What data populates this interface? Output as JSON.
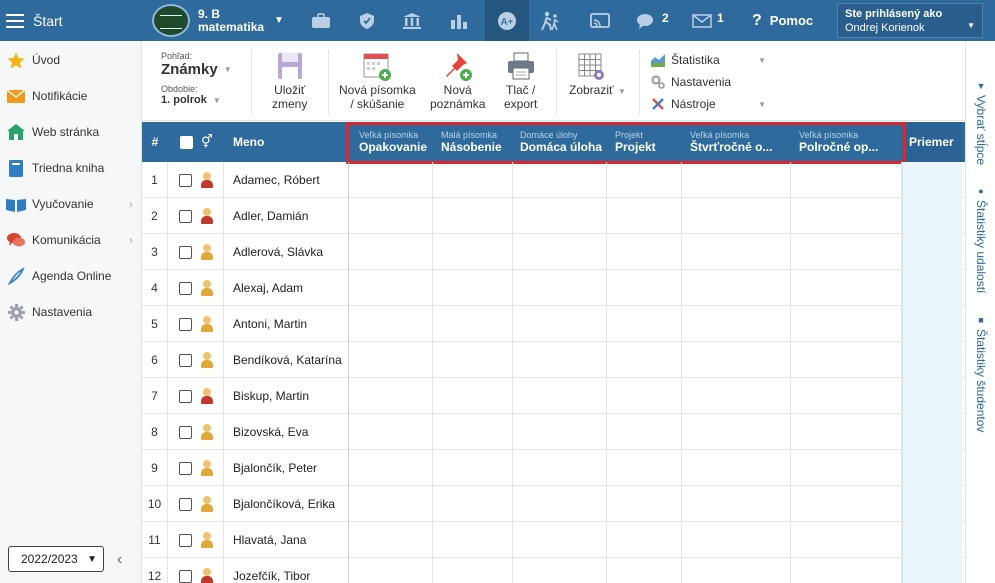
{
  "topbar": {
    "start_label": "Štart",
    "class_line1": "9. B",
    "class_line2": "matematika",
    "chat_count": "2",
    "mail_count": "1",
    "help_label": "Pomoc",
    "user_line1": "Ste prihlásený ako",
    "user_line2": "Ondrej Korienok",
    "icons": [
      "briefcase-icon",
      "shield-icon",
      "bank-icon",
      "bar-chart-icon",
      "grades-icon",
      "hiking-icon",
      "cast-icon",
      "chat-icon",
      "mail-icon",
      "help-icon"
    ]
  },
  "sidebar": {
    "items": [
      {
        "label": "Úvod",
        "icon": "star-icon",
        "color": "#f2b517"
      },
      {
        "label": "Notifikácie",
        "icon": "envelope-icon",
        "color": "#f09a1a"
      },
      {
        "label": "Web stránka",
        "icon": "home-icon",
        "color": "#2aa36b"
      },
      {
        "label": "Triedna kniha",
        "icon": "book-icon",
        "color": "#2e7fc1"
      },
      {
        "label": "Vyučovanie",
        "icon": "open-book-icon",
        "color": "#2e7fc1"
      },
      {
        "label": "Komunikácia",
        "icon": "chat-bubbles-icon",
        "color": "#d6452e"
      },
      {
        "label": "Agenda Online",
        "icon": "pen-icon",
        "color": "#3b86c8"
      },
      {
        "label": "Nastavenia",
        "icon": "gear-icon",
        "color": "#9aa1a8"
      }
    ],
    "year": "2022/2023"
  },
  "toolbar": {
    "view_small": "Pohľad:",
    "view_value": "Známky",
    "period_small": "Obdobie:",
    "period_value": "1. polrok",
    "save_l1": "Uložiť",
    "save_l2": "zmeny",
    "new_test_l1": "Nová písomka",
    "new_test_l2": "/ skúšanie",
    "new_note_l1": "Nová",
    "new_note_l2": "poznámka",
    "print_l1": "Tlač /",
    "print_l2": "export",
    "display_label": "Zobraziť",
    "statistics": "Štatistika",
    "settings": "Nastavenia",
    "tools": "Nástroje"
  },
  "rightrail": {
    "columns": "Vybrať stĺpce",
    "event_stats": "Štatistiky udalostí",
    "student_stats": "Štatistiky študentov"
  },
  "grid": {
    "num_header": "#",
    "name_header": "Meno",
    "avg_header": "Priemer",
    "columns": [
      {
        "category": "Veľká písomka",
        "name": "Opakovanie"
      },
      {
        "category": "Malá písomka",
        "name": "Násobenie"
      },
      {
        "category": "Domáce úlohy",
        "name": "Domáca úloha"
      },
      {
        "category": "Projekt",
        "name": "Projekt"
      },
      {
        "category": "Veľká písomka",
        "name": "Štvrťročné o..."
      },
      {
        "category": "Veľká písomka",
        "name": "Polročné op..."
      }
    ],
    "students": [
      {
        "num": "1",
        "name": "Adamec, Róbert",
        "gender": "male"
      },
      {
        "num": "2",
        "name": "Adler, Damián",
        "gender": "male"
      },
      {
        "num": "3",
        "name": "Adlerová, Slávka",
        "gender": "female"
      },
      {
        "num": "4",
        "name": "Alexaj, Adam",
        "gender": "female"
      },
      {
        "num": "5",
        "name": "Antoni, Martin",
        "gender": "female"
      },
      {
        "num": "6",
        "name": "Bendíková, Katarína",
        "gender": "female"
      },
      {
        "num": "7",
        "name": "Biskup, Martin",
        "gender": "male"
      },
      {
        "num": "8",
        "name": "Bizovská, Eva",
        "gender": "female"
      },
      {
        "num": "9",
        "name": "Bjalončík, Peter",
        "gender": "female"
      },
      {
        "num": "10",
        "name": "Bjalončíková, Erika",
        "gender": "female"
      },
      {
        "num": "11",
        "name": "Hlavatá, Jana",
        "gender": "female"
      },
      {
        "num": "12",
        "name": "Jozefčík, Tibor",
        "gender": "male"
      }
    ]
  }
}
